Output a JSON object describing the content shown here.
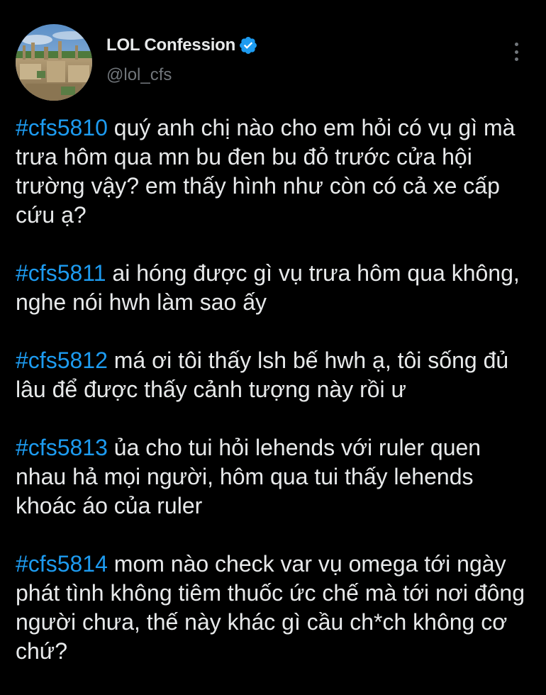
{
  "account": {
    "display_name": "LOL Confession",
    "handle": "@lol_cfs",
    "verified_icon": "verified-badge-icon",
    "accent_color": "#1d9bf0"
  },
  "menu": {
    "icon": "more-vertical-icon"
  },
  "posts": [
    {
      "hashtag": "#cfs5810",
      "text": " quý anh chị nào cho em hỏi có vụ gì mà trưa hôm qua mn bu đen bu đỏ trước cửa hội trường vậy? em thấy hình như còn có cả xe cấp cứu ạ?"
    },
    {
      "hashtag": "#cfs5811",
      "text": " ai hóng được gì vụ trưa hôm qua không, nghe nói hwh làm sao ấy"
    },
    {
      "hashtag": "#cfs5812",
      "text": " má ơi tôi thấy lsh bế hwh ạ, tôi sống đủ lâu để được thấy cảnh tượng này rồi ư"
    },
    {
      "hashtag": "#cfs5813",
      "text": " ủa cho tui hỏi lehends với ruler quen nhau hả mọi người, hôm qua tui thấy lehends khoác áo của ruler"
    },
    {
      "hashtag": "#cfs5814",
      "text": " mom nào check var vụ omega tới ngày phát tình không tiêm thuốc ức chế mà tới nơi đông người chưa, thế này khác gì cầu ch*ch không cơ chứ?"
    }
  ]
}
